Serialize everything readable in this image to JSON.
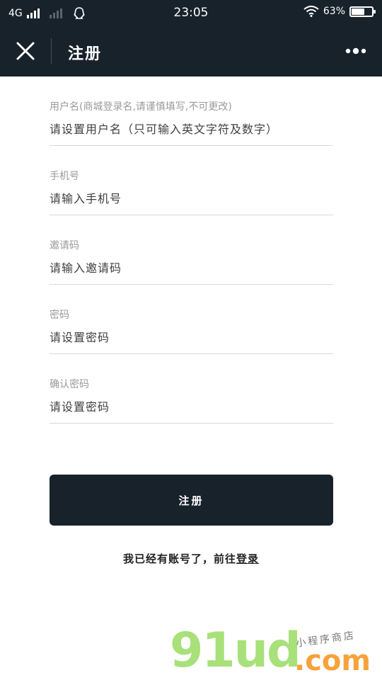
{
  "status_bar": {
    "network": "4G",
    "time": "23:05",
    "battery_percent": "63%",
    "battery_level": 0.63
  },
  "nav": {
    "title": "注册"
  },
  "form": {
    "fields": [
      {
        "label": "用户名(商城登录名,请谨慎填写,不可更改)",
        "placeholder": "请设置用户名（只可输入英文字符及数字）",
        "value": ""
      },
      {
        "label": "手机号",
        "placeholder": "请输入手机号",
        "value": ""
      },
      {
        "label": "邀请码",
        "placeholder": "请输入邀请码",
        "value": ""
      },
      {
        "label": "密码",
        "placeholder": "请设置密码",
        "value": ""
      },
      {
        "label": "确认密码",
        "placeholder": "请设置密码",
        "value": ""
      }
    ],
    "submit_label": "注册"
  },
  "login": {
    "prefix": "我已经有账号了，前往",
    "link": "登录"
  },
  "watermark": {
    "big": "91ud",
    "com": ".com",
    "small": "小程序商店"
  },
  "colors": {
    "header_bg": "#18222b",
    "button_bg": "#18222b",
    "watermark_green": "#a8e07a",
    "watermark_orange": "#f7a23a"
  }
}
